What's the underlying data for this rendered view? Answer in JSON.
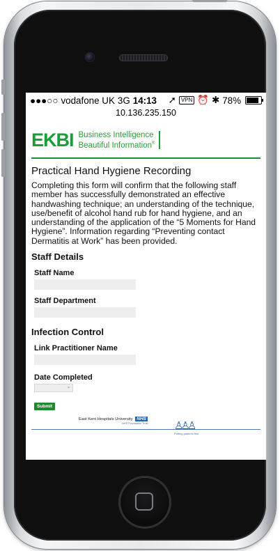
{
  "status_bar": {
    "signal": "●●●○○",
    "carrier": "vodafone UK",
    "network": "3G",
    "time": "14:13",
    "location_icon": "➚",
    "vpn": "VPN",
    "alarm_icon": "⏰",
    "bluetooth_icon": "✱",
    "battery": "78%",
    "battery_level": 0.78
  },
  "address_bar": {
    "url": "10.136.235.150"
  },
  "brand": {
    "name": "EKBI",
    "tagline_1": "Business Intelligence",
    "tagline_2": "Beautiful Information",
    "tagline_mark": "®",
    "accent_color": "#1a9e3a"
  },
  "form": {
    "title": "Practical Hand Hygiene Recording",
    "intro": "Completing this form will confirm that the following staff member has successfully demonstrated an effective handwashing technique; an understanding of the technique, use/benefit of alcohol hand rub for hand hygiene, and an understanding of the application of the “5 Moments for Hand Hygiene”. Information regarding “Preventing contact Dermatitis at Work” has been provided.",
    "section_staff": "Staff Details",
    "label_staff_name": "Staff Name",
    "value_staff_name": "",
    "label_staff_department": "Staff Department",
    "value_staff_department": "",
    "section_infection": "Infection Control",
    "label_link_practitioner": "Link Practitioner Name",
    "value_link_practitioner": "",
    "label_date_completed": "Date Completed",
    "value_date_completed": "",
    "submit_label": "Submit"
  },
  "footer": {
    "hospital": "East Kent Hospitals University",
    "nhs": "NHS",
    "trust": "NHS Foundation Trust",
    "slogan": "Putting patients first"
  }
}
